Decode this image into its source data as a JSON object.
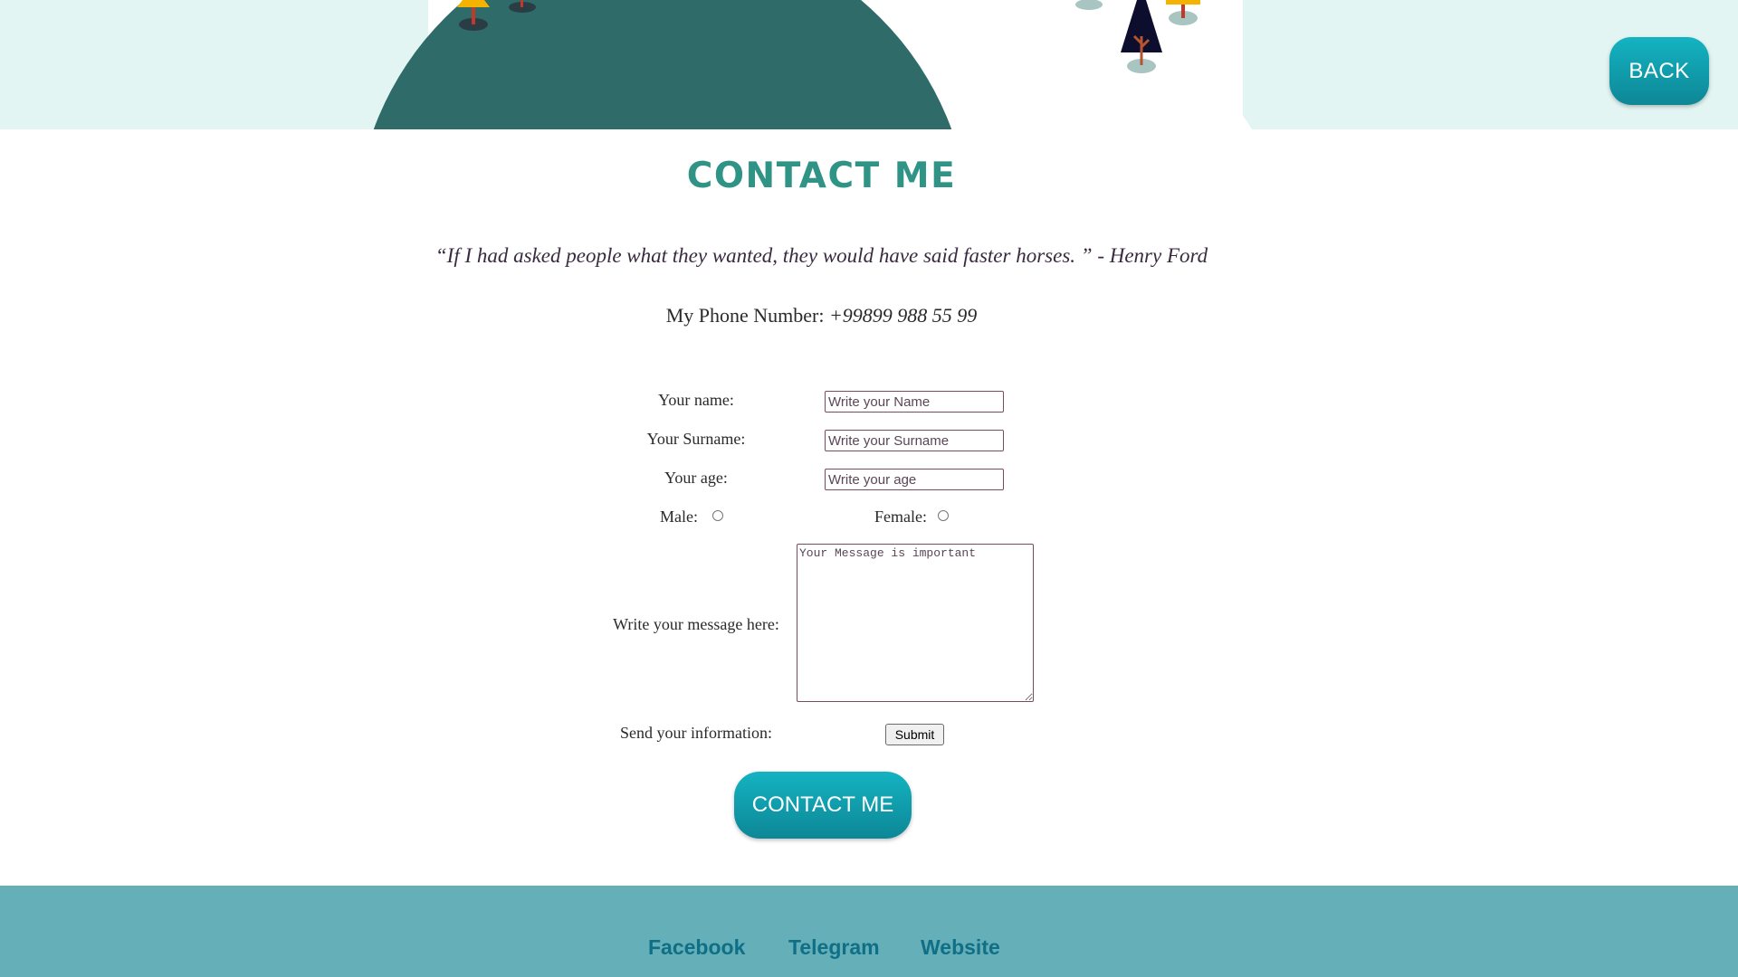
{
  "header": {
    "back_label": "BACK"
  },
  "main": {
    "title": "CONTACT ME",
    "quote": "“If I had asked people what they wanted, they would have said faster horses. ” - Henry Ford",
    "phone_label": "My Phone Number:",
    "phone_number": "+99899 988 55 99"
  },
  "form": {
    "name_label": "Your name:",
    "name_placeholder": "Write your Name",
    "surname_label": "Your Surname:",
    "surname_placeholder": "Write your Surname",
    "age_label": "Your age:",
    "age_placeholder": "Write your age",
    "male_label": "Male:",
    "female_label": "Female:",
    "message_label": "Write your message here:",
    "message_placeholder": "Your Message is important",
    "send_label": "Send your information:",
    "submit_label": "Submit"
  },
  "cta": {
    "contact_label": "CONTACT ME"
  },
  "footer": {
    "links": [
      "Facebook",
      "Telegram",
      "Website"
    ]
  },
  "colors": {
    "accent": "#14b3c2",
    "title": "#2f9485",
    "hero_bg": "#e2f5f3",
    "hill": "#2e6b69",
    "footer_bg": "#65afb8",
    "footer_link": "#0f6f86"
  }
}
